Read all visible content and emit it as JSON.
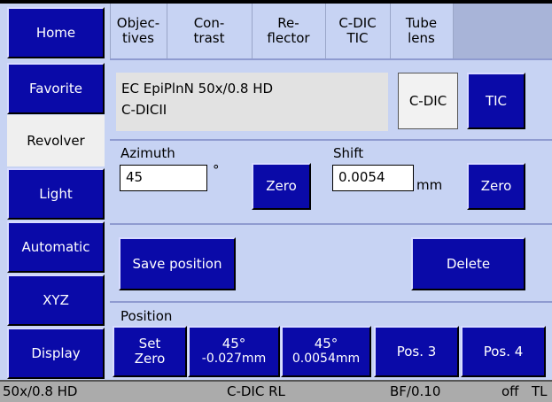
{
  "nav": {
    "home": "Home",
    "favorite": "Favorite",
    "revolver": "Revolver",
    "light": "Light",
    "automatic": "Automatic",
    "xyz": "XYZ",
    "display": "Display"
  },
  "tabs": {
    "objectives": [
      "Objec-",
      "tives"
    ],
    "contrast": [
      "Con-",
      "trast"
    ],
    "reflector": [
      "Re-",
      "flector"
    ],
    "cdic_tic": [
      "C-DIC",
      "TIC"
    ],
    "tube_lens": [
      "Tube",
      "lens"
    ]
  },
  "objective": {
    "line1": "EC EpiPlnN 50x/0.8 HD",
    "line2": "C-DICII"
  },
  "mode": {
    "cdic": "C-DIC",
    "tic": "TIC"
  },
  "azimuth": {
    "label": "Azimuth",
    "value": "45",
    "unit": "°",
    "zero": "Zero"
  },
  "shift": {
    "label": "Shift",
    "value": "0.0054",
    "unit": "mm",
    "zero": "Zero"
  },
  "actions": {
    "save": "Save position",
    "delete": "Delete"
  },
  "position": {
    "label": "Position",
    "set_zero": [
      "Set",
      "Zero"
    ],
    "pos1": [
      "45°",
      "-0.027mm"
    ],
    "pos2": [
      "45°",
      "0.0054mm"
    ],
    "pos3": "Pos. 3",
    "pos4": "Pos. 4"
  },
  "status": {
    "objective": "50x/0.8 HD",
    "contrast": "C-DIC RL",
    "aperture": "BF/0.10",
    "light": "off",
    "mode": "TL"
  }
}
